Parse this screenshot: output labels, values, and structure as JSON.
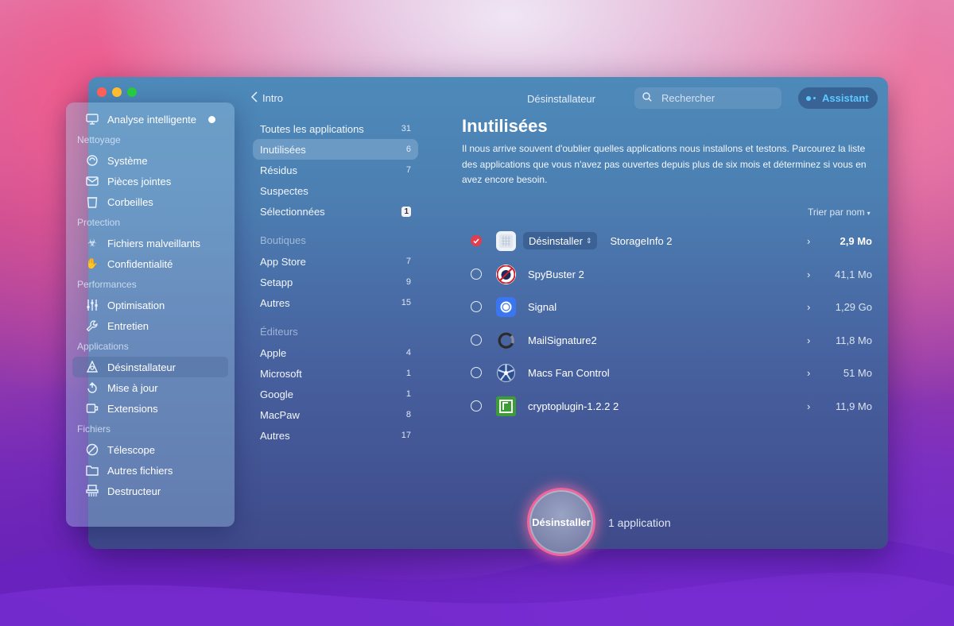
{
  "topbar": {
    "back_label": "Intro",
    "title": "Désinstallateur",
    "search_placeholder": "Rechercher",
    "assistant_label": "Assistant"
  },
  "sidebar": {
    "top_item": {
      "label": "Analyse intelligente",
      "icon": "monitor-icon"
    },
    "sections": [
      {
        "header": "Nettoyage",
        "items": [
          {
            "label": "Système",
            "icon": "system-icon"
          },
          {
            "label": "Pièces jointes",
            "icon": "envelope-icon"
          },
          {
            "label": "Corbeilles",
            "icon": "trash-icon"
          }
        ]
      },
      {
        "header": "Protection",
        "items": [
          {
            "label": "Fichiers malveillants",
            "icon": "biohazard-icon"
          },
          {
            "label": "Confidentialité",
            "icon": "hand-icon"
          }
        ]
      },
      {
        "header": "Performances",
        "items": [
          {
            "label": "Optimisation",
            "icon": "sliders-icon"
          },
          {
            "label": "Entretien",
            "icon": "wrench-icon"
          }
        ]
      },
      {
        "header": "Applications",
        "items": [
          {
            "label": "Désinstallateur",
            "icon": "uninstaller-icon"
          },
          {
            "label": "Mise à jour",
            "icon": "update-icon"
          },
          {
            "label": "Extensions",
            "icon": "extensions-icon"
          }
        ]
      },
      {
        "header": "Fichiers",
        "items": [
          {
            "label": "Télescope",
            "icon": "telescope-icon"
          },
          {
            "label": "Autres fichiers",
            "icon": "folder-icon"
          },
          {
            "label": "Destructeur",
            "icon": "shredder-icon"
          }
        ]
      }
    ]
  },
  "categories": {
    "main": [
      {
        "label": "Toutes les applications",
        "count": "31"
      },
      {
        "label": "Inutilisées",
        "count": "6"
      },
      {
        "label": "Résidus",
        "count": "7"
      },
      {
        "label": "Suspectes",
        "count": ""
      },
      {
        "label": "Sélectionnées",
        "count": "1"
      }
    ],
    "stores_header": "Boutiques",
    "stores": [
      {
        "label": "App Store",
        "count": "7"
      },
      {
        "label": "Setapp",
        "count": "9"
      },
      {
        "label": "Autres",
        "count": "15"
      }
    ],
    "publishers_header": "Éditeurs",
    "publishers": [
      {
        "label": "Apple",
        "count": "4"
      },
      {
        "label": "Microsoft",
        "count": "1"
      },
      {
        "label": "Google",
        "count": "1"
      },
      {
        "label": "MacPaw",
        "count": "8"
      },
      {
        "label": "Autres",
        "count": "17"
      }
    ]
  },
  "main": {
    "title": "Inutilisées",
    "description": "Il nous arrive souvent d'oublier quelles applications nous installons et testons. Parcourez la liste des applications que vous n'avez pas ouvertes depuis plus de six mois et déterminez si vous en avez encore besoin.",
    "sort_label": "Trier par nom",
    "uninstall_pill": "Désinstaller",
    "apps": [
      {
        "name": "StorageInfo 2",
        "size": "2,9 Mo",
        "checked": true
      },
      {
        "name": "SpyBuster 2",
        "size": "41,1 Mo",
        "checked": false
      },
      {
        "name": "Signal",
        "size": "1,29 Go",
        "checked": false
      },
      {
        "name": "MailSignature2",
        "size": "11,8 Mo",
        "checked": false
      },
      {
        "name": "Macs Fan Control",
        "size": "51 Mo",
        "checked": false
      },
      {
        "name": "cryptoplugin-1.2.2 2",
        "size": "11,9 Mo",
        "checked": false
      }
    ]
  },
  "action": {
    "button_label": "Désinstaller",
    "summary": "1 application"
  },
  "colors": {
    "accent_red": "#e23c4e",
    "assistant_blue": "#5ec9ff",
    "button_ring": "#f0669c"
  }
}
